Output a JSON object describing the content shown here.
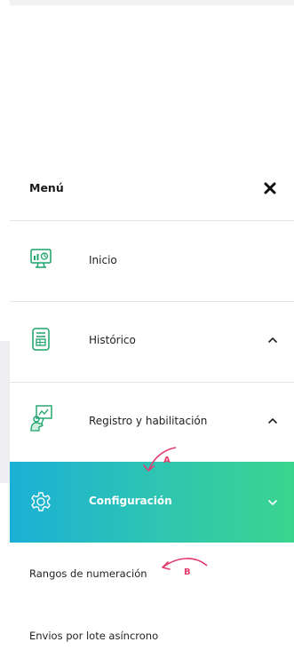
{
  "menu": {
    "title": "Menú",
    "items": [
      {
        "label": "Inicio",
        "icon": "dashboard-monitor-icon",
        "chevron": "none"
      },
      {
        "label": "Histórico",
        "icon": "document-list-icon",
        "chevron": "up"
      },
      {
        "label": "Registro y habilitación",
        "icon": "presenter-board-icon",
        "chevron": "up"
      },
      {
        "label": "Configuración",
        "icon": "gear-icon",
        "chevron": "down",
        "active": true
      }
    ],
    "sub_items": [
      {
        "label": "Rangos de numeración"
      },
      {
        "label": "Envios por lote asíncrono"
      }
    ]
  },
  "annotations": [
    {
      "letter": "A"
    },
    {
      "letter": "B"
    }
  ],
  "colors": {
    "accent_start": "#1bb0d6",
    "accent_end": "#3bd48e",
    "icon_green": "#1aa36a",
    "annotation": "#e23b6e"
  }
}
